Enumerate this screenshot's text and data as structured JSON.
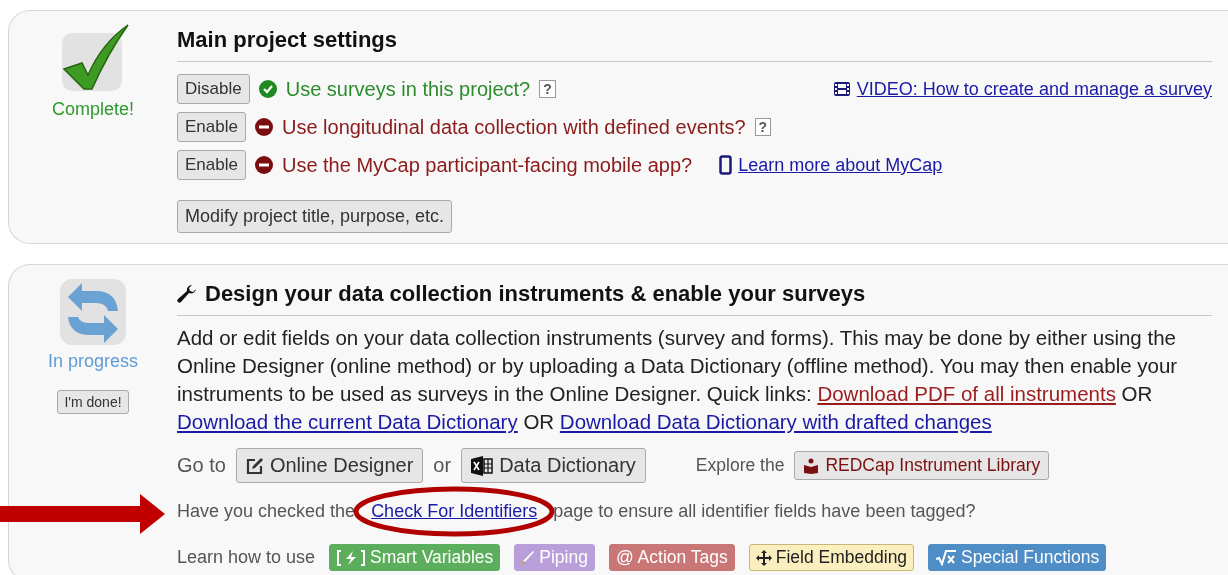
{
  "settings_card": {
    "status": {
      "kind": "complete",
      "label": "Complete!"
    },
    "title": "Main project settings",
    "features": [
      {
        "button": "Disable",
        "enabled": true,
        "label": "Use surveys in this project?",
        "help": "?",
        "link": {
          "kind": "video",
          "text": "VIDEO: How to create and manage a survey"
        }
      },
      {
        "button": "Enable",
        "enabled": false,
        "label": "Use longitudinal data collection with defined events?",
        "help": "?"
      },
      {
        "button": "Enable",
        "enabled": false,
        "label": "Use the MyCap participant-facing mobile app?",
        "link": {
          "kind": "mobile",
          "text": "Learn more about MyCap"
        }
      }
    ],
    "modify_button": "Modify project title, purpose, etc."
  },
  "design_card": {
    "status": {
      "kind": "in_progress",
      "label": "In progress"
    },
    "done_button": "I'm done!",
    "title": "Design your data collection instruments & enable your surveys",
    "description": "Add or edit fields on your data collection instruments (survey and forms). This may be done by either using the Online Designer (online method) or by uploading a Data Dictionary (offline method). You may then enable your instruments to be used as surveys in the Online Designer. Quick links:",
    "quick_links": [
      {
        "text": "Download PDF of all instruments",
        "sep": "OR",
        "highlight": true
      },
      {
        "text": "Download the current Data Dictionary",
        "sep": "OR",
        "highlight": false
      },
      {
        "text": "Download Data Dictionary with drafted changes",
        "highlight": false
      }
    ],
    "goto_label": "Go to",
    "designer_button": "Online Designer",
    "or_label": "or",
    "dictionary_button": "Data Dictionary",
    "explore_label": "Explore the",
    "library_button": "REDCap Instrument Library",
    "identifiers": {
      "before": "Have you checked the",
      "link": "Check For Identifiers",
      "after": "page to ensure all identifier fields have been tagged?"
    },
    "learn_label": "Learn how to use",
    "tags": [
      {
        "kind": "smart",
        "label": "Smart Variables",
        "color": "#5cae5c"
      },
      {
        "kind": "piping",
        "label": "Piping",
        "color": "#b89fd9"
      },
      {
        "kind": "plain",
        "label": "@ Action Tags",
        "color": "#c97676"
      },
      {
        "kind": "embed",
        "label": "Field Embedding",
        "color": "#fbefc0"
      },
      {
        "kind": "functions",
        "label": "Special Functions",
        "color": "#4f8dc6"
      }
    ]
  }
}
